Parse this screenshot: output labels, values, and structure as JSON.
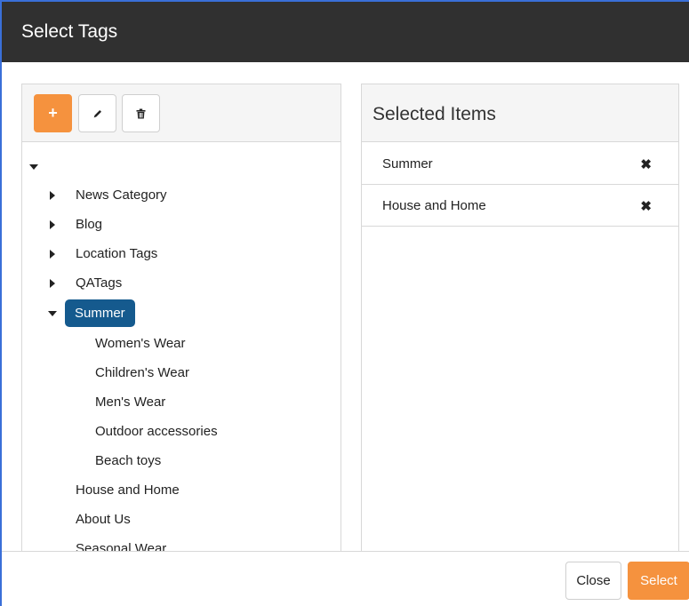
{
  "dialog": {
    "title": "Select Tags"
  },
  "toolbar": {
    "add_label": "+",
    "edit_icon": "pencil-icon",
    "delete_icon": "trash-icon"
  },
  "tree": {
    "nodes": [
      {
        "label": "News Category",
        "expanded": false
      },
      {
        "label": "Blog",
        "expanded": false
      },
      {
        "label": "Location Tags",
        "expanded": false
      },
      {
        "label": "QATags",
        "expanded": false
      },
      {
        "label": "Summer",
        "expanded": true,
        "selected": true,
        "children": [
          "Women's Wear",
          "Children's Wear",
          "Men's Wear",
          "Outdoor accessories",
          "Beach toys"
        ]
      },
      {
        "label": "House and Home"
      },
      {
        "label": "About Us"
      },
      {
        "label": "Seasonal Wear"
      }
    ]
  },
  "selected_panel": {
    "title": "Selected Items",
    "items": [
      {
        "label": "Summer"
      },
      {
        "label": "House and Home"
      }
    ],
    "remove_symbol": "✖"
  },
  "footer": {
    "close_label": "Close",
    "select_label": "Select"
  },
  "colors": {
    "header_bg": "#303030",
    "accent": "#f5923e",
    "selected_node": "#155a8e"
  }
}
